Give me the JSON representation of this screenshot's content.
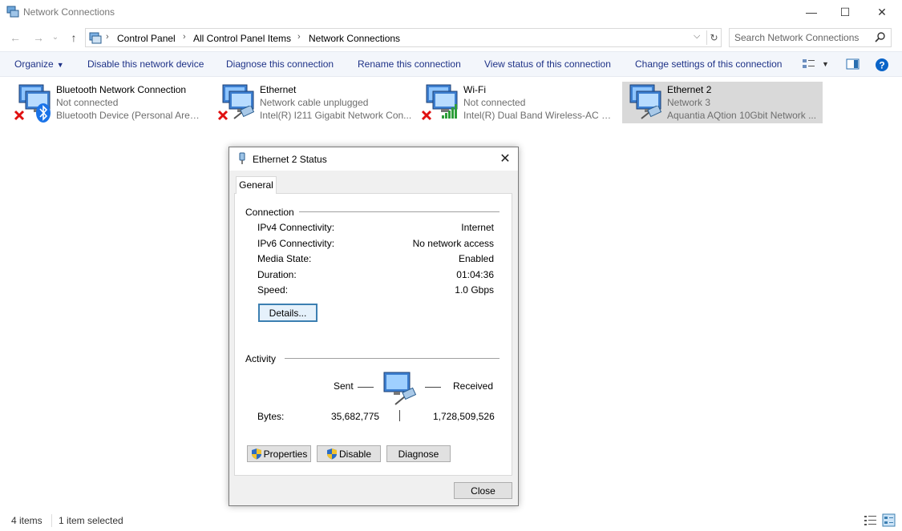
{
  "window": {
    "title": "Network Connections",
    "controls": {
      "minimize": "—",
      "maximize": "☐",
      "close": "✕"
    }
  },
  "nav": {
    "back": "←",
    "forward": "→",
    "recent": "⌄",
    "up": "↑",
    "breadcrumb": [
      "Control Panel",
      "All Control Panel Items",
      "Network Connections"
    ],
    "breadcrumb_sep": "›",
    "dropdown": "⌵",
    "refresh": "↻",
    "search_placeholder": "Search Network Connections"
  },
  "commands": {
    "organize": "Organize",
    "disable_device": "Disable this network device",
    "diagnose": "Diagnose this connection",
    "rename": "Rename this connection",
    "view_status": "View status of this connection",
    "change_settings": "Change settings of this connection"
  },
  "connections": [
    {
      "name": "Bluetooth Network Connection",
      "status": "Not connected",
      "device": "Bluetooth Device (Personal Area ...",
      "overlay": "red-x-icon",
      "badge": "bluetooth-icon"
    },
    {
      "name": "Ethernet",
      "status": "Network cable unplugged",
      "device": "Intel(R) I211 Gigabit Network Con...",
      "overlay": "red-x-icon",
      "badge": "ethernet-cable-icon"
    },
    {
      "name": "Wi-Fi",
      "status": "Not connected",
      "device": "Intel(R) Dual Band Wireless-AC 31...",
      "overlay": "red-x-icon",
      "badge": "wifi-signal-icon"
    },
    {
      "name": "Ethernet 2",
      "status": "Network 3",
      "device": "Aquantia AQtion 10Gbit Network ...",
      "badge": "ethernet-cable-icon",
      "selected": true
    }
  ],
  "statusbar": {
    "items": "4 items",
    "selected": "1 item selected"
  },
  "dialog": {
    "title": "Ethernet 2 Status",
    "close": "✕",
    "tab": "General",
    "connection_group": "Connection",
    "properties": [
      {
        "label": "IPv4 Connectivity:",
        "value": "Internet"
      },
      {
        "label": "IPv6 Connectivity:",
        "value": "No network access"
      },
      {
        "label": "Media State:",
        "value": "Enabled"
      },
      {
        "label": "Duration:",
        "value": "01:04:36"
      },
      {
        "label": "Speed:",
        "value": "1.0 Gbps"
      }
    ],
    "details_button": "Details...",
    "activity_group": "Activity",
    "sent_label": "Sent",
    "received_label": "Received",
    "bytes_label": "Bytes:",
    "bytes_sent": "35,682,775",
    "bytes_received": "1,728,509,526",
    "properties_button": "Properties",
    "disable_button": "Disable",
    "diagnose_button": "Diagnose",
    "close_button": "Close"
  },
  "colors": {
    "command_text": "#1e3287",
    "selected_bg": "#d9d9d9",
    "help_blue": "#0a64c8"
  }
}
